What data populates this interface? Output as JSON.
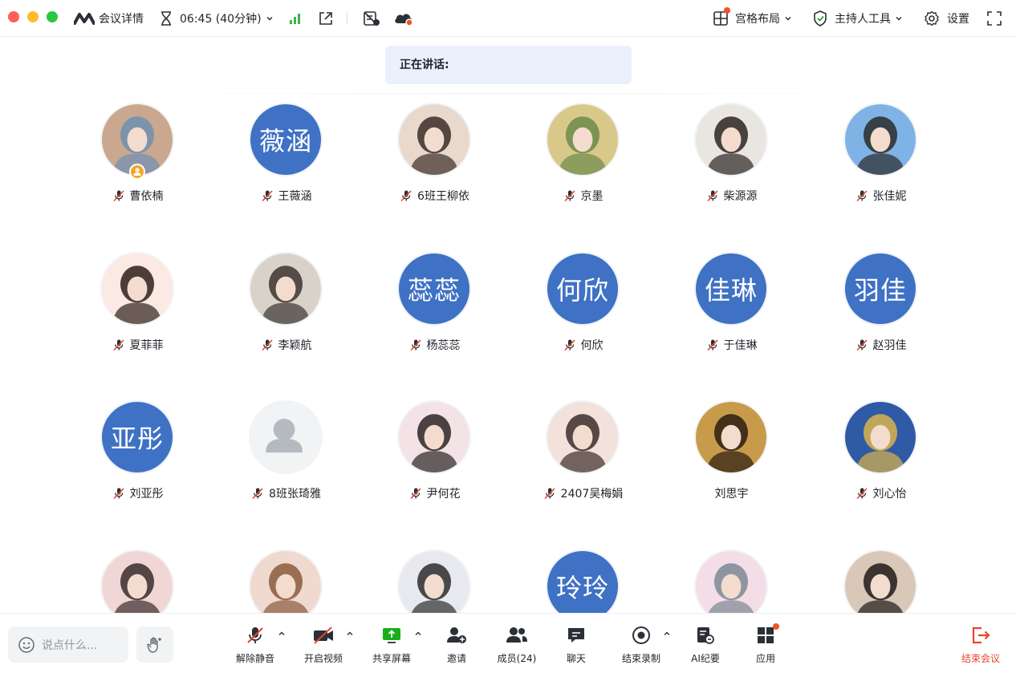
{
  "titlebar": {
    "meeting_details": "会议详情",
    "timer": "06:45 (40分钟)",
    "layout_label": "宫格布局",
    "host_tools_label": "主持人工具",
    "settings_label": "设置"
  },
  "speaking": {
    "label": "正在讲话:"
  },
  "participants": [
    {
      "name": "曹依楠",
      "avatar": "photo",
      "muted": true,
      "host": true,
      "tone": [
        "#c9a88f",
        "#6f8fb3"
      ]
    },
    {
      "name": "王薇涵",
      "avatar_text": "薇涵",
      "muted": true
    },
    {
      "name": "6班王柳依",
      "avatar": "photo",
      "muted": true,
      "tone": [
        "#e9d9cc",
        "#3a2d28"
      ]
    },
    {
      "name": "京墨",
      "avatar": "photo",
      "muted": true,
      "tone": [
        "#d8c98a",
        "#6d8a4a"
      ]
    },
    {
      "name": "柴源源",
      "avatar": "photo",
      "muted": true,
      "tone": [
        "#e9e6e2",
        "#2b2522"
      ]
    },
    {
      "name": "张佳妮",
      "avatar": "photo",
      "muted": true,
      "tone": [
        "#7fb3e6",
        "#2a2a2a"
      ]
    },
    {
      "name": "夏菲菲",
      "avatar": "photo",
      "muted": true,
      "tone": [
        "#fbe9e4",
        "#2d1f1a"
      ]
    },
    {
      "name": "李颖航",
      "avatar": "photo",
      "muted": true,
      "tone": [
        "#d9d2c9",
        "#3b3530"
      ]
    },
    {
      "name": "杨蕊蕊",
      "avatar_text": "蕊蕊",
      "muted": true
    },
    {
      "name": "何欣",
      "avatar_text": "何欣",
      "muted": true
    },
    {
      "name": "于佳琳",
      "avatar_text": "佳琳",
      "muted": true
    },
    {
      "name": "赵羽佳",
      "avatar_text": "羽佳",
      "muted": true
    },
    {
      "name": "刘亚彤",
      "avatar_text": "亚彤",
      "muted": true
    },
    {
      "name": "8班张琦雅",
      "avatar": "default",
      "muted": true
    },
    {
      "name": "尹何花",
      "avatar": "photo",
      "muted": true,
      "tone": [
        "#f4e3e6",
        "#2b2424"
      ]
    },
    {
      "name": "2407吴梅娟",
      "avatar": "photo",
      "muted": true,
      "tone": [
        "#f3e1dc",
        "#3a2e2a"
      ]
    },
    {
      "name": "刘思宇",
      "avatar": "photo",
      "muted": false,
      "tone": [
        "#c89b4b",
        "#2a1d10"
      ]
    },
    {
      "name": "刘心怡",
      "avatar": "photo",
      "muted": true,
      "tone": [
        "#2f5aa6",
        "#d9b44a"
      ]
    },
    {
      "name": "",
      "avatar": "photo",
      "muted": true,
      "tone": [
        "#f1d6d6",
        "#3b2b2b"
      ]
    },
    {
      "name": "",
      "avatar": "photo",
      "muted": true,
      "tone": [
        "#f0d9cf",
        "#8a5a3c"
      ]
    },
    {
      "name": "",
      "avatar": "photo",
      "muted": true,
      "tone": [
        "#e8e9ee",
        "#2c2c2e"
      ]
    },
    {
      "name": "",
      "avatar_text": "玲玲",
      "muted": true
    },
    {
      "name": "",
      "avatar": "photo",
      "muted": true,
      "tone": [
        "#f3dde6",
        "#7d8794"
      ]
    },
    {
      "name": "",
      "avatar": "photo",
      "muted": true,
      "tone": [
        "#d9c7b8",
        "#1e1a18"
      ]
    }
  ],
  "toolbar": {
    "chat_placeholder": "说点什么...",
    "unmute": "解除静音",
    "start_video": "开启视频",
    "share_screen": "共享屏幕",
    "invite": "邀请",
    "members": "成员(24)",
    "chat": "聊天",
    "stop_recording": "结束录制",
    "ai_minutes": "AI纪要",
    "apps": "应用",
    "end_meeting": "结束会议"
  },
  "colors": {
    "avatar_blue": "#3f71c4",
    "accent_green": "#1aad19",
    "end_red": "#e8452d",
    "badge_red": "#f0522b"
  }
}
